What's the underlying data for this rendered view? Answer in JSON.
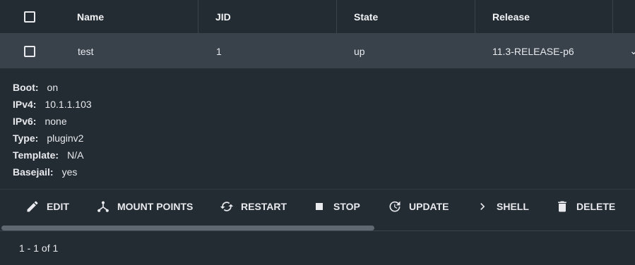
{
  "table": {
    "columns": [
      "Name",
      "JID",
      "State",
      "Release"
    ],
    "rows": [
      {
        "name": "test",
        "jid": "1",
        "state": "up",
        "release": "11.3-RELEASE-p6"
      }
    ]
  },
  "details": [
    {
      "label": "Boot:",
      "value": "on"
    },
    {
      "label": "IPv4:",
      "value": "10.1.1.103"
    },
    {
      "label": "IPv6:",
      "value": "none"
    },
    {
      "label": "Type:",
      "value": "pluginv2"
    },
    {
      "label": "Template:",
      "value": "N/A"
    },
    {
      "label": "Basejail:",
      "value": "yes"
    }
  ],
  "actions": {
    "edit": "EDIT",
    "mount_points": "MOUNT POINTS",
    "restart": "RESTART",
    "stop": "STOP",
    "update": "UPDATE",
    "shell": "SHELL",
    "delete": "DELETE"
  },
  "pagination": {
    "range": "1 - 1 of 1"
  },
  "icons": [
    "checkbox-icon",
    "chevron-down-icon",
    "pencil-icon",
    "mount-points-icon",
    "restart-icon",
    "stop-icon",
    "update-icon",
    "chevron-right-icon",
    "trash-icon"
  ],
  "colors": {
    "background": "#232b33",
    "row_highlight": "#39424b",
    "text": "#e8eaed"
  }
}
